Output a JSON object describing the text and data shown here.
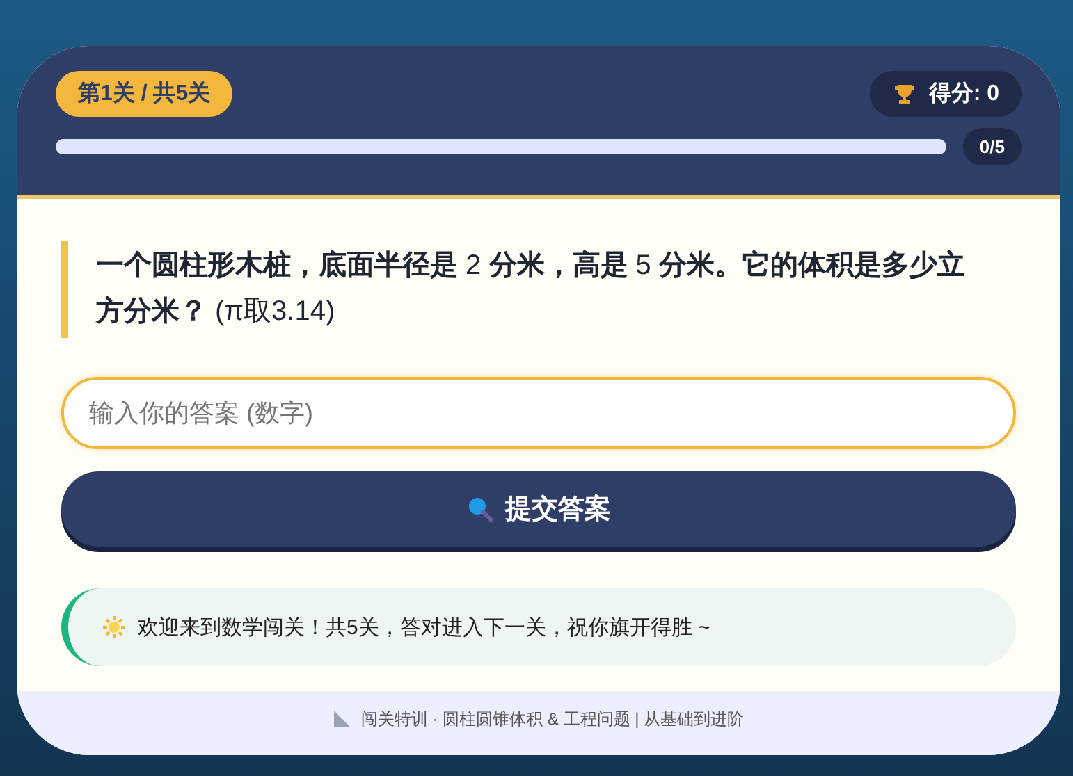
{
  "level_badge": "第1关 / 共5关",
  "score": "得分: 0",
  "progress": {
    "level": 0,
    "reading": "0/5"
  },
  "question": "**一个圆柱形木桩，底面半径是** 2 **分米，高是** 5 **分米。它的体积是多少立方分米？** (π取3.14)",
  "answer_field": {
    "placeholder": "输入你的答案 (数字)"
  },
  "submit_button": "提交答案",
  "message": "欢迎来到数学闯关！共5关，答对进入下一关，祝你旗开得胜 ~",
  "footer": "闯关特训 · 圆柱圆锥体积 & 工程问题 | 从基础到进阶"
}
